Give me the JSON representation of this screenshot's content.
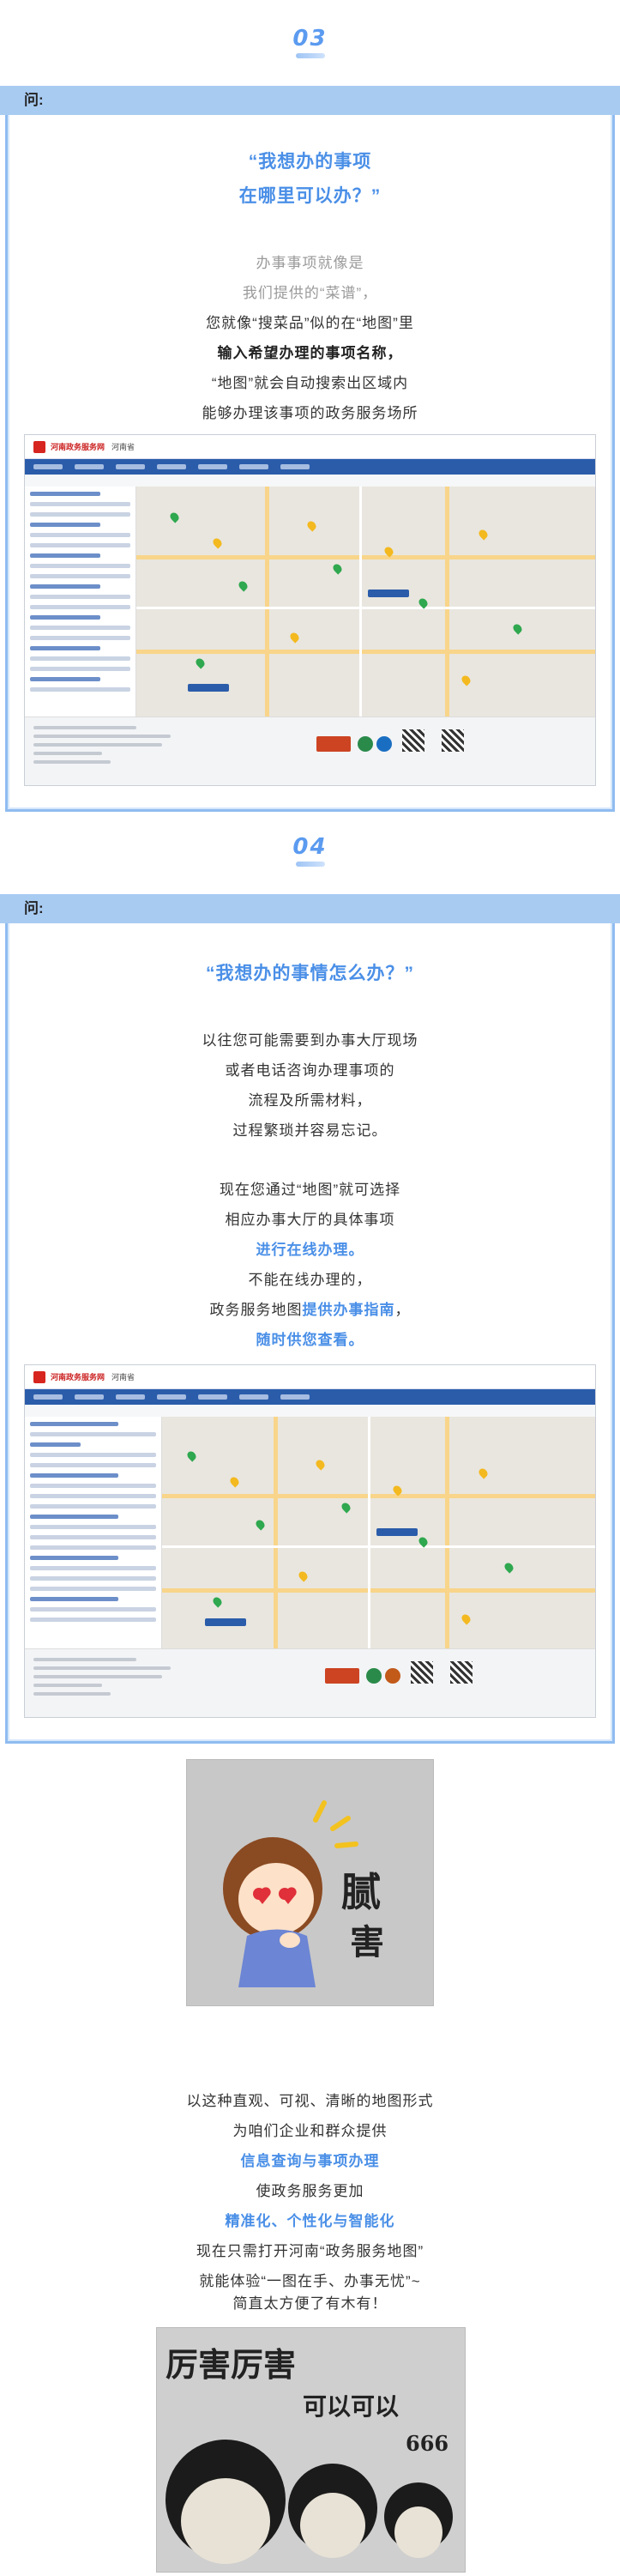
{
  "section3": {
    "number": "03",
    "question_label": "问:",
    "title_line1": "“我想办的事项",
    "title_line2": "在哪里可以办？”",
    "lines": [
      {
        "text": "办事事项就像是",
        "style": "gray"
      },
      {
        "text": "我们提供的“菜谱”，",
        "style": "gray"
      },
      {
        "text": "您就像“搜菜品”似的在“地图”里",
        "style": "dark"
      },
      {
        "text": "输入希望办理的事项名称，",
        "style": "bold"
      },
      {
        "text": "“地图”就会自动搜索出区域内",
        "style": "dark"
      },
      {
        "text": "能够办理该事项的政务服务场所",
        "style": "dark"
      }
    ]
  },
  "section4": {
    "number": "04",
    "question_label": "问:",
    "title_line1": "“我想办的事情怎么办？”",
    "lines_a": [
      "以往您可能需要到办事大厅现场",
      "或者电话咨询办理事项的",
      "流程及所需材料，",
      "过程繁琐并容易忘记。"
    ],
    "lines_b": {
      "l1": "现在您通过“地图”就可选择",
      "l2": "相应办事大厅的具体事项",
      "l3": "进行在线办理。",
      "l4": "不能在线办理的，",
      "l5_prefix": "政务服务地图",
      "l5_highlight": "提供办事指南",
      "l5_suffix": "，",
      "l6": "随时供您查看。"
    }
  },
  "screenshot": {
    "site_name": "河南政务服务网",
    "region": "河南省"
  },
  "meme1": {
    "text_top": "腻",
    "text_bottom": "害"
  },
  "closing": {
    "l1": "以这种直观、可视、清晰的地图形式",
    "l2": "为咱们企业和群众提供",
    "l3": "信息查询与事项办理",
    "l4": "使政务服务更加",
    "l5": "精准化、个性化与智能化",
    "l6": "现在只需打开河南“政务服务地图”",
    "l7": "就能体验“一图在手、办事无忧”~",
    "l8": "简直太方便了有木有！"
  },
  "meme2": {
    "title": "厉害厉害",
    "sub": "可以可以",
    "num": "666"
  },
  "colors": {
    "accent_blue": "#4a8fe7",
    "question_bar": "#a8cbf2",
    "frame_border": "#8fbcf0"
  }
}
